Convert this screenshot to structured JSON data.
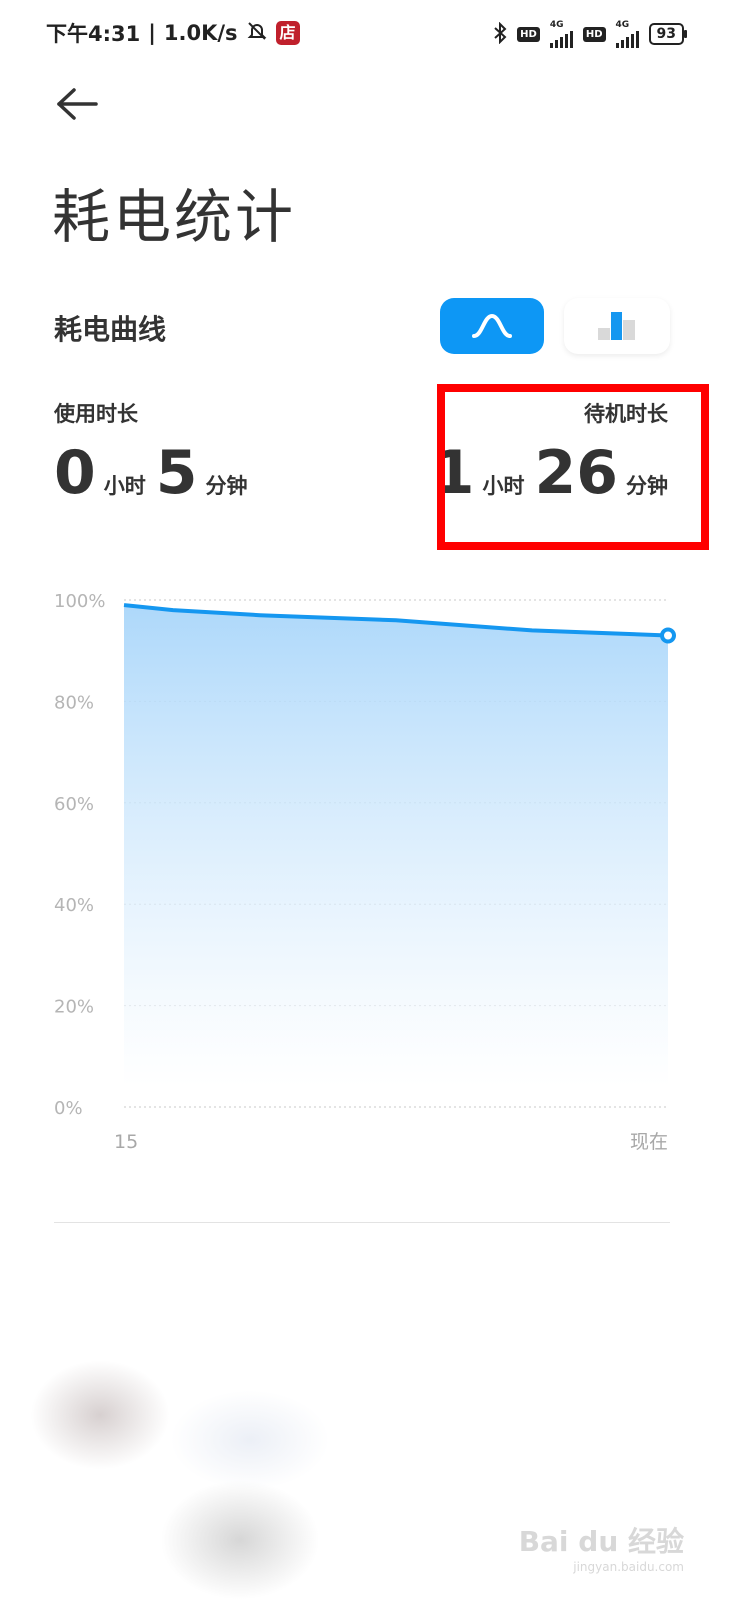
{
  "status_bar": {
    "time": "下午4:31",
    "speed": "1.0K/s",
    "shop_icon_text": "店",
    "hd1": "HD",
    "hd2": "HD",
    "net1": "4G",
    "net2": "4G",
    "battery": "93"
  },
  "page": {
    "title": "耗电统计"
  },
  "section": {
    "title": "耗电曲线"
  },
  "usage": {
    "label": "使用时长",
    "hours": "0",
    "hours_unit": "小时",
    "minutes": "5",
    "minutes_unit": "分钟"
  },
  "standby": {
    "label": "待机时长",
    "hours": "1",
    "hours_unit": "小时",
    "minutes": "26",
    "minutes_unit": "分钟"
  },
  "chart_data": {
    "type": "area",
    "x_labels": [
      "15",
      "现在"
    ],
    "y_ticks": [
      "100%",
      "80%",
      "60%",
      "40%",
      "20%",
      "0%"
    ],
    "ylim": [
      0,
      100
    ],
    "x": [
      0,
      0.09,
      0.25,
      0.5,
      0.75,
      1.0
    ],
    "values": [
      99,
      98,
      97,
      96,
      94,
      93
    ],
    "line_color": "#1597f0",
    "fill_color": "#b5dcfb"
  },
  "watermark": {
    "brand": "Bai du 经验",
    "url": "jingyan.baidu.com"
  }
}
